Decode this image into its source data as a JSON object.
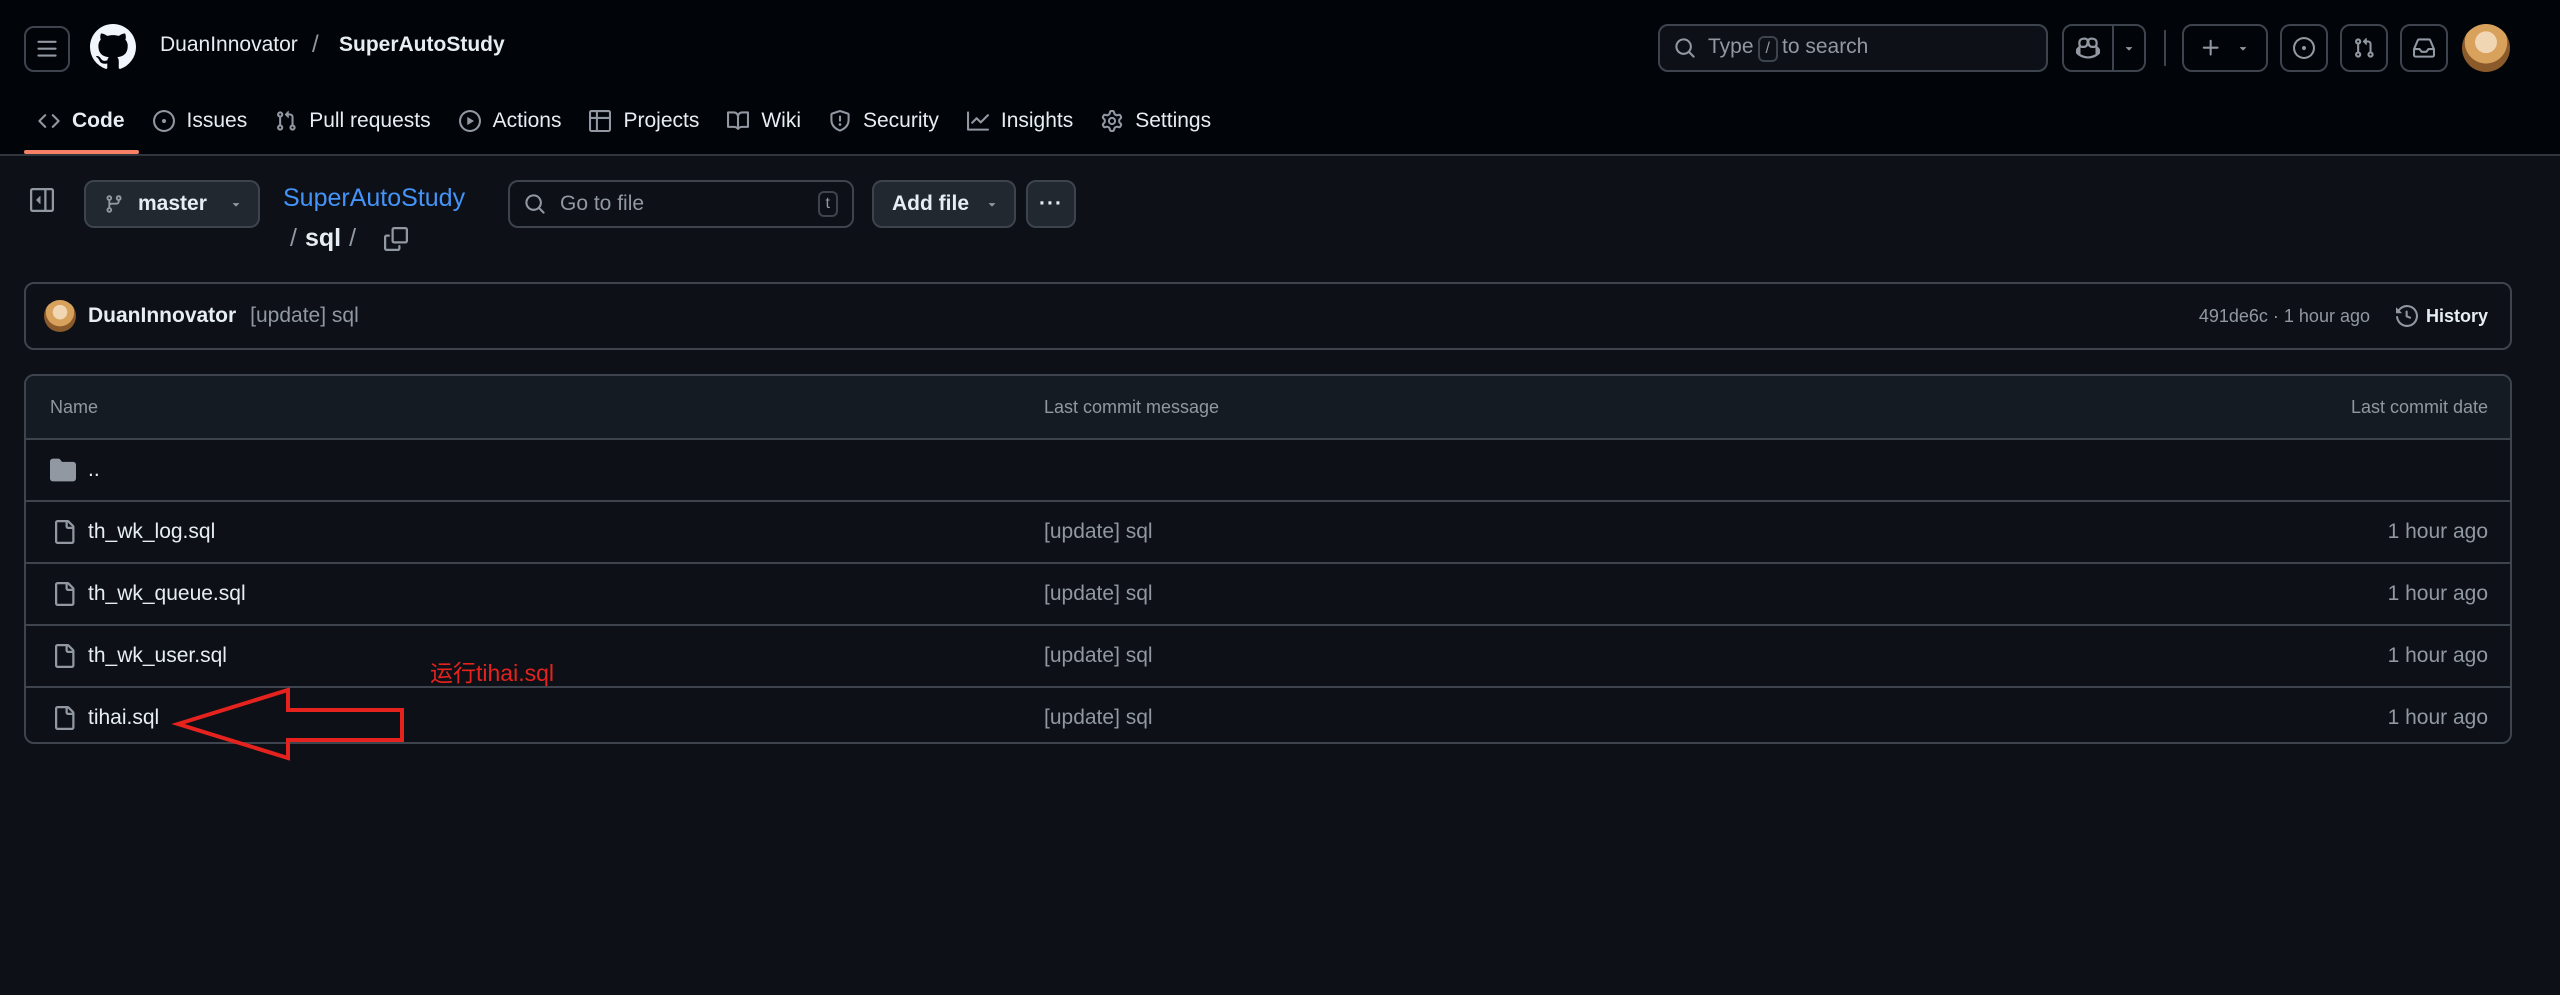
{
  "header": {
    "owner": "DuanInnovator",
    "separator": "/",
    "repo": "SuperAutoStudy",
    "search_prefix": "Type",
    "search_key": "/",
    "search_suffix": "to search"
  },
  "nav": [
    {
      "label": "Code",
      "icon": "code-icon",
      "active": true
    },
    {
      "label": "Issues",
      "icon": "issue-icon"
    },
    {
      "label": "Pull requests",
      "icon": "pull-request-icon"
    },
    {
      "label": "Actions",
      "icon": "play-icon"
    },
    {
      "label": "Projects",
      "icon": "table-icon"
    },
    {
      "label": "Wiki",
      "icon": "book-icon"
    },
    {
      "label": "Security",
      "icon": "shield-icon"
    },
    {
      "label": "Insights",
      "icon": "graph-icon"
    },
    {
      "label": "Settings",
      "icon": "gear-icon"
    }
  ],
  "toolbar": {
    "branch": "master",
    "repo_link": "SuperAutoStudy",
    "path_sep": "/",
    "path_dir": "sql",
    "path_trail": "/",
    "goto_placeholder": "Go to file",
    "goto_key": "t",
    "add_file": "Add file",
    "more": "···"
  },
  "commit": {
    "author": "DuanInnovator",
    "message": "[update] sql",
    "meta": "491de6c · 1 hour ago",
    "history": "History"
  },
  "table": {
    "headers": {
      "name": "Name",
      "message": "Last commit message",
      "date": "Last commit date"
    },
    "parent": "..",
    "rows": [
      {
        "name": "th_wk_log.sql",
        "message": "[update] sql",
        "date": "1 hour ago"
      },
      {
        "name": "th_wk_queue.sql",
        "message": "[update] sql",
        "date": "1 hour ago"
      },
      {
        "name": "th_wk_user.sql",
        "message": "[update] sql",
        "date": "1 hour ago"
      },
      {
        "name": "tihai.sql",
        "message": "[update] sql",
        "date": "1 hour ago"
      }
    ]
  },
  "annotation": {
    "text": "运行tihai.sql",
    "color": "#e5221d"
  },
  "colors": {
    "accent": "#f78166",
    "link": "#4493f8",
    "background": "#0d1117"
  }
}
